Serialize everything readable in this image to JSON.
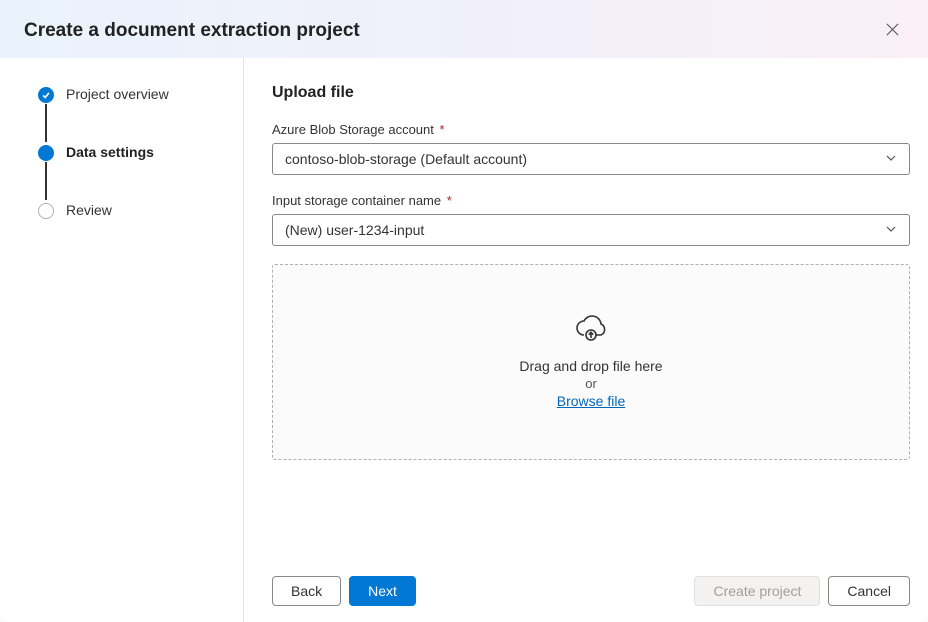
{
  "header": {
    "title": "Create a document extraction project"
  },
  "steps": [
    {
      "label": "Project overview",
      "state": "completed"
    },
    {
      "label": "Data settings",
      "state": "current"
    },
    {
      "label": "Review",
      "state": "upcoming"
    }
  ],
  "main": {
    "section_title": "Upload file",
    "storage_account": {
      "label": "Azure Blob Storage account",
      "value": "contoso-blob-storage (Default account)"
    },
    "container_name": {
      "label": "Input storage container name",
      "value": "(New) user-1234-input"
    },
    "dropzone": {
      "line1": "Drag and drop file here",
      "or": "or",
      "browse": "Browse file"
    }
  },
  "footer": {
    "back": "Back",
    "next": "Next",
    "create": "Create project",
    "cancel": "Cancel"
  }
}
